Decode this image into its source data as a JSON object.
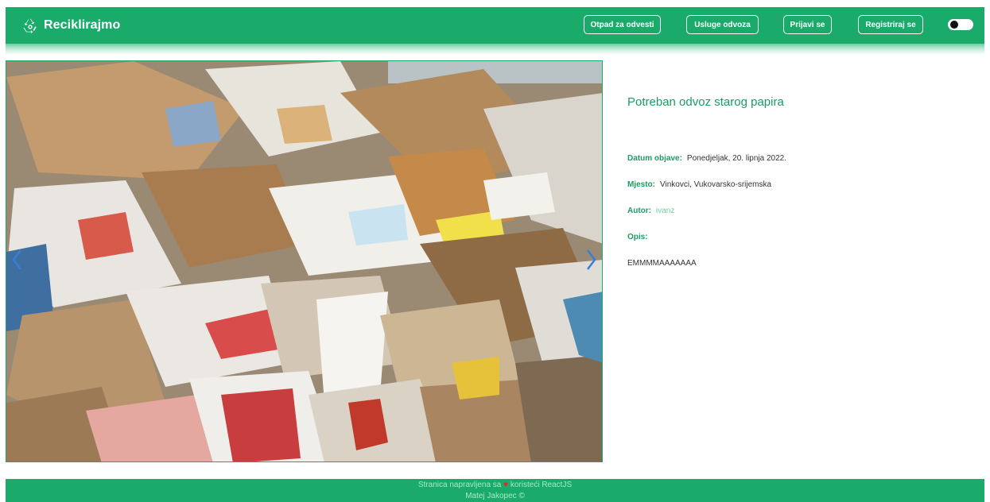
{
  "navbar": {
    "brand": "Reciklirajmo",
    "links": [
      {
        "label": "Otpad za odvesti"
      },
      {
        "label": "Usluge odvoza"
      },
      {
        "label": "Prijavi se"
      },
      {
        "label": "Registriraj se"
      }
    ],
    "theme_toggle_icon": "dark-mode-toggle"
  },
  "post": {
    "title": "Potreban odvoz starog papira",
    "fields": {
      "date_label": "Datum objave:",
      "date_value": "Ponedjeljak, 20. lipnja 2022.",
      "place_label": "Mjesto:",
      "place_value": "Vinkovci, Vukovarsko-srijemska",
      "author_label": "Autor:",
      "author_value": "ivanz",
      "desc_label": "Opis:",
      "desc_value": "EMMMMAAAAAAA"
    }
  },
  "footer": {
    "line1_before": "Stranica napravljena sa",
    "line1_after": "koristeći ReactJS",
    "line2": "Matej Jakopec ©"
  },
  "colors": {
    "primary": "#1aab6a",
    "label_green": "#1e9a62",
    "heart": "#e3262a"
  },
  "icons": [
    "recycle-icon",
    "chevron-left-icon",
    "chevron-right-icon",
    "heart-icon"
  ]
}
